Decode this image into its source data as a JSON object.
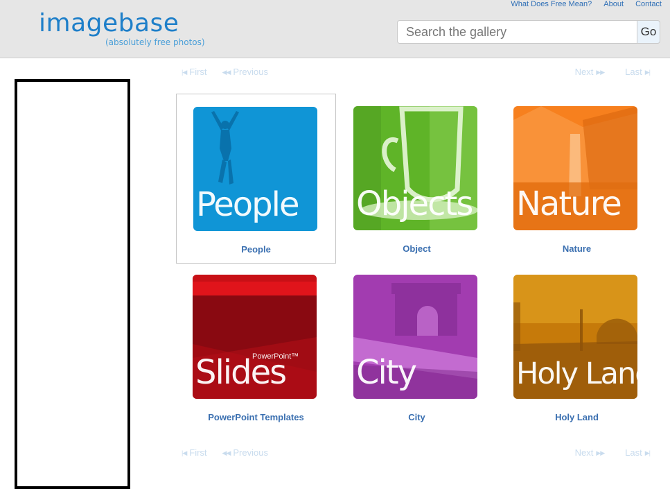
{
  "header": {
    "logo": "imagebase",
    "tagline": "(absolutely free photos)",
    "links": [
      "What Does Free Mean?",
      "About",
      "Contact"
    ],
    "search": {
      "placeholder": "Search the gallery",
      "value": "",
      "button_label": "Go"
    }
  },
  "pager": {
    "first": "First",
    "previous": "Previous",
    "next": "Next",
    "last": "Last"
  },
  "gallery": {
    "items": [
      {
        "thumb_text": "People",
        "caption": "People",
        "color": "#0a8fd2"
      },
      {
        "thumb_text": "Objects",
        "caption": "Object",
        "color": "#5fb428"
      },
      {
        "thumb_text": "Nature",
        "caption": "Nature",
        "color": "#f7801e"
      },
      {
        "thumb_text": "Slides",
        "thumb_sub": "PowerPoint™",
        "caption": "PowerPoint Templates",
        "color": "#a00a12"
      },
      {
        "thumb_text": "City",
        "caption": "City",
        "color": "#a23cb0"
      },
      {
        "thumb_text": "Holy Land",
        "caption": "Holy Land",
        "color": "#c67a0a"
      }
    ]
  }
}
